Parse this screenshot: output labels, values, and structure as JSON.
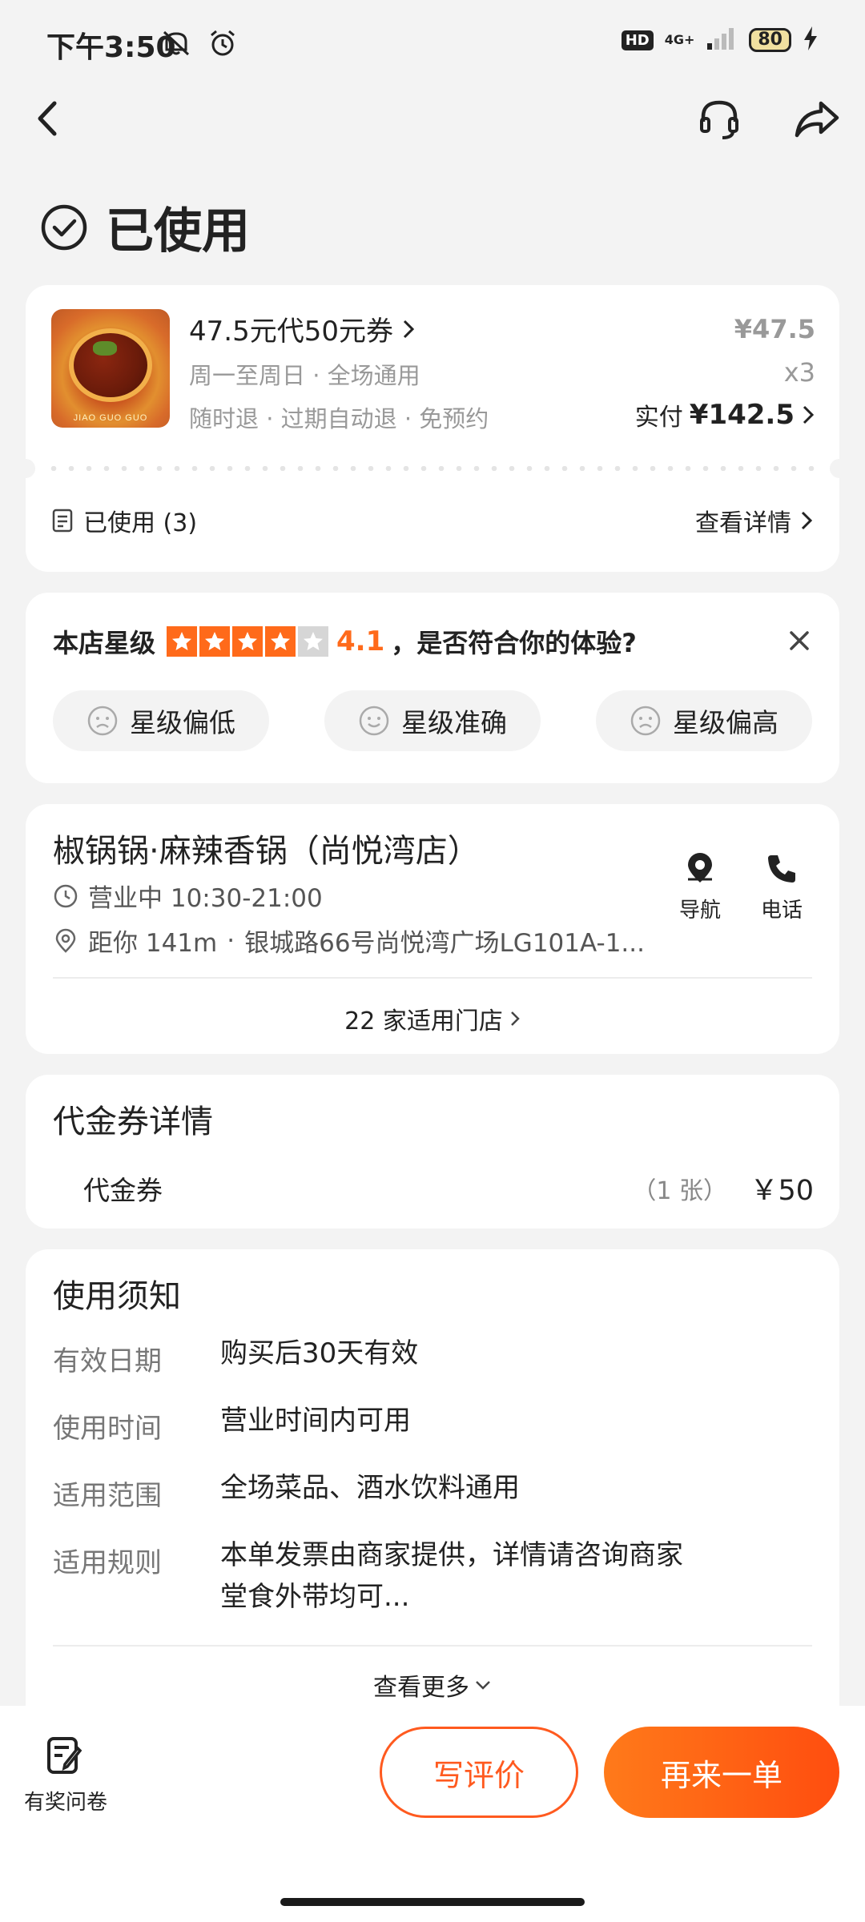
{
  "status": {
    "time": "下午3:50",
    "hd": "HD",
    "network_top": "4G+",
    "battery": "80"
  },
  "title": "已使用",
  "deal": {
    "title": "47.5元代50元券",
    "sub1": "周一至周日 · 全场通用",
    "sub2": "随时退 · 过期自动退 · 免预约",
    "price": "¥47.5",
    "qty": "x3",
    "paid_label": "实付",
    "paid_amount": "¥142.5",
    "image_brand": "JIAO GUO GUO",
    "used_label": "已使用 (3)",
    "detail_link": "查看详情"
  },
  "rating": {
    "label": "本店星级",
    "value": "4.1",
    "stars_filled": 4,
    "question": "，是否符合你的体验?",
    "options": [
      "星级偏低",
      "星级准确",
      "星级偏高"
    ]
  },
  "store": {
    "name": "椒锅锅·麻辣香锅（尚悦湾店）",
    "hours": "营业中 10:30-21:00",
    "distance": "距你 141m",
    "address": "银城路66号尚悦湾广场LG101A-1...",
    "nav_label": "导航",
    "call_label": "电话",
    "stores_link": "22 家适用门店"
  },
  "voucher": {
    "title": "代金券详情",
    "name": "代金券",
    "count": "（1 张）",
    "price": "￥50"
  },
  "notice": {
    "title": "使用须知",
    "rows": [
      {
        "label": "有效日期",
        "value": "购买后30天有效"
      },
      {
        "label": "使用时间",
        "value": "营业时间内可用"
      },
      {
        "label": "适用范围",
        "value": "全场菜品、酒水饮料通用"
      },
      {
        "label": "适用规则",
        "value": "本单发票由商家提供，详情请咨询商家",
        "value2": "堂食外带均可..."
      }
    ],
    "more": "查看更多"
  },
  "bottom": {
    "survey": "有奖问卷",
    "review": "写评价",
    "reorder": "再来一单"
  },
  "colors": {
    "accent": "#ff5a1f",
    "star": "#ff6a1a",
    "background": "#f3f3f3"
  }
}
